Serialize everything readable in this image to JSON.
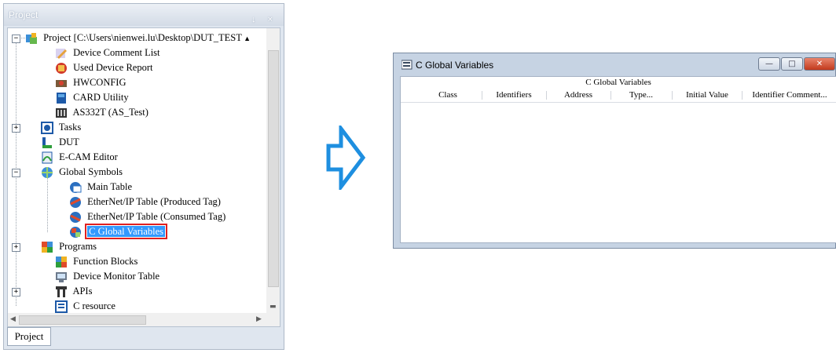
{
  "project_panel": {
    "title": "Project",
    "title_buttons": "↓ ×",
    "tab_label": "Project",
    "tree": [
      {
        "label": "Project [C:\\Users\\nienwei.lu\\Desktop\\DUT_TEST",
        "icon": "project-icon"
      },
      {
        "label": "Device Comment List",
        "icon": "pencil-icon"
      },
      {
        "label": "Used Device Report",
        "icon": "report-icon"
      },
      {
        "label": "HWCONFIG",
        "icon": "hardware-icon"
      },
      {
        "label": "CARD Utility",
        "icon": "card-icon"
      },
      {
        "label": "AS332T  (AS_Test)",
        "icon": "plc-icon"
      },
      {
        "label": "Tasks",
        "icon": "tasks-icon"
      },
      {
        "label": "DUT",
        "icon": "dut-icon"
      },
      {
        "label": "E-CAM Editor",
        "icon": "ecam-icon"
      },
      {
        "label": "Global Symbols",
        "icon": "global-symbols-icon"
      },
      {
        "label": "Main Table",
        "icon": "table-icon"
      },
      {
        "label": "EtherNet/IP Table (Produced Tag)",
        "icon": "ethernet-produced-icon"
      },
      {
        "label": "EtherNet/IP Table (Consumed Tag)",
        "icon": "ethernet-consumed-icon"
      },
      {
        "label": "C Global Variables",
        "icon": "c-global-variables-icon"
      },
      {
        "label": "Programs",
        "icon": "programs-icon"
      },
      {
        "label": "Function Blocks",
        "icon": "function-blocks-icon"
      },
      {
        "label": "Device Monitor Table",
        "icon": "monitor-icon"
      },
      {
        "label": "APIs",
        "icon": "apis-icon"
      },
      {
        "label": "C resource",
        "icon": "c-resource-icon"
      }
    ]
  },
  "cgv_window": {
    "title": "C Global Variables",
    "group_header": "C Global Variables",
    "columns": [
      "Class",
      "Identifiers",
      "Address",
      "Type...",
      "Initial Value",
      "Identifier Comment..."
    ],
    "buttons": {
      "minimize": "—",
      "maximize": "□",
      "close": "✕"
    }
  },
  "colors": {
    "selection": "#3399ff",
    "highlight_box": "#e02020",
    "arrow_fill": "#ffffff",
    "arrow_stroke": "#1e8fe0"
  }
}
